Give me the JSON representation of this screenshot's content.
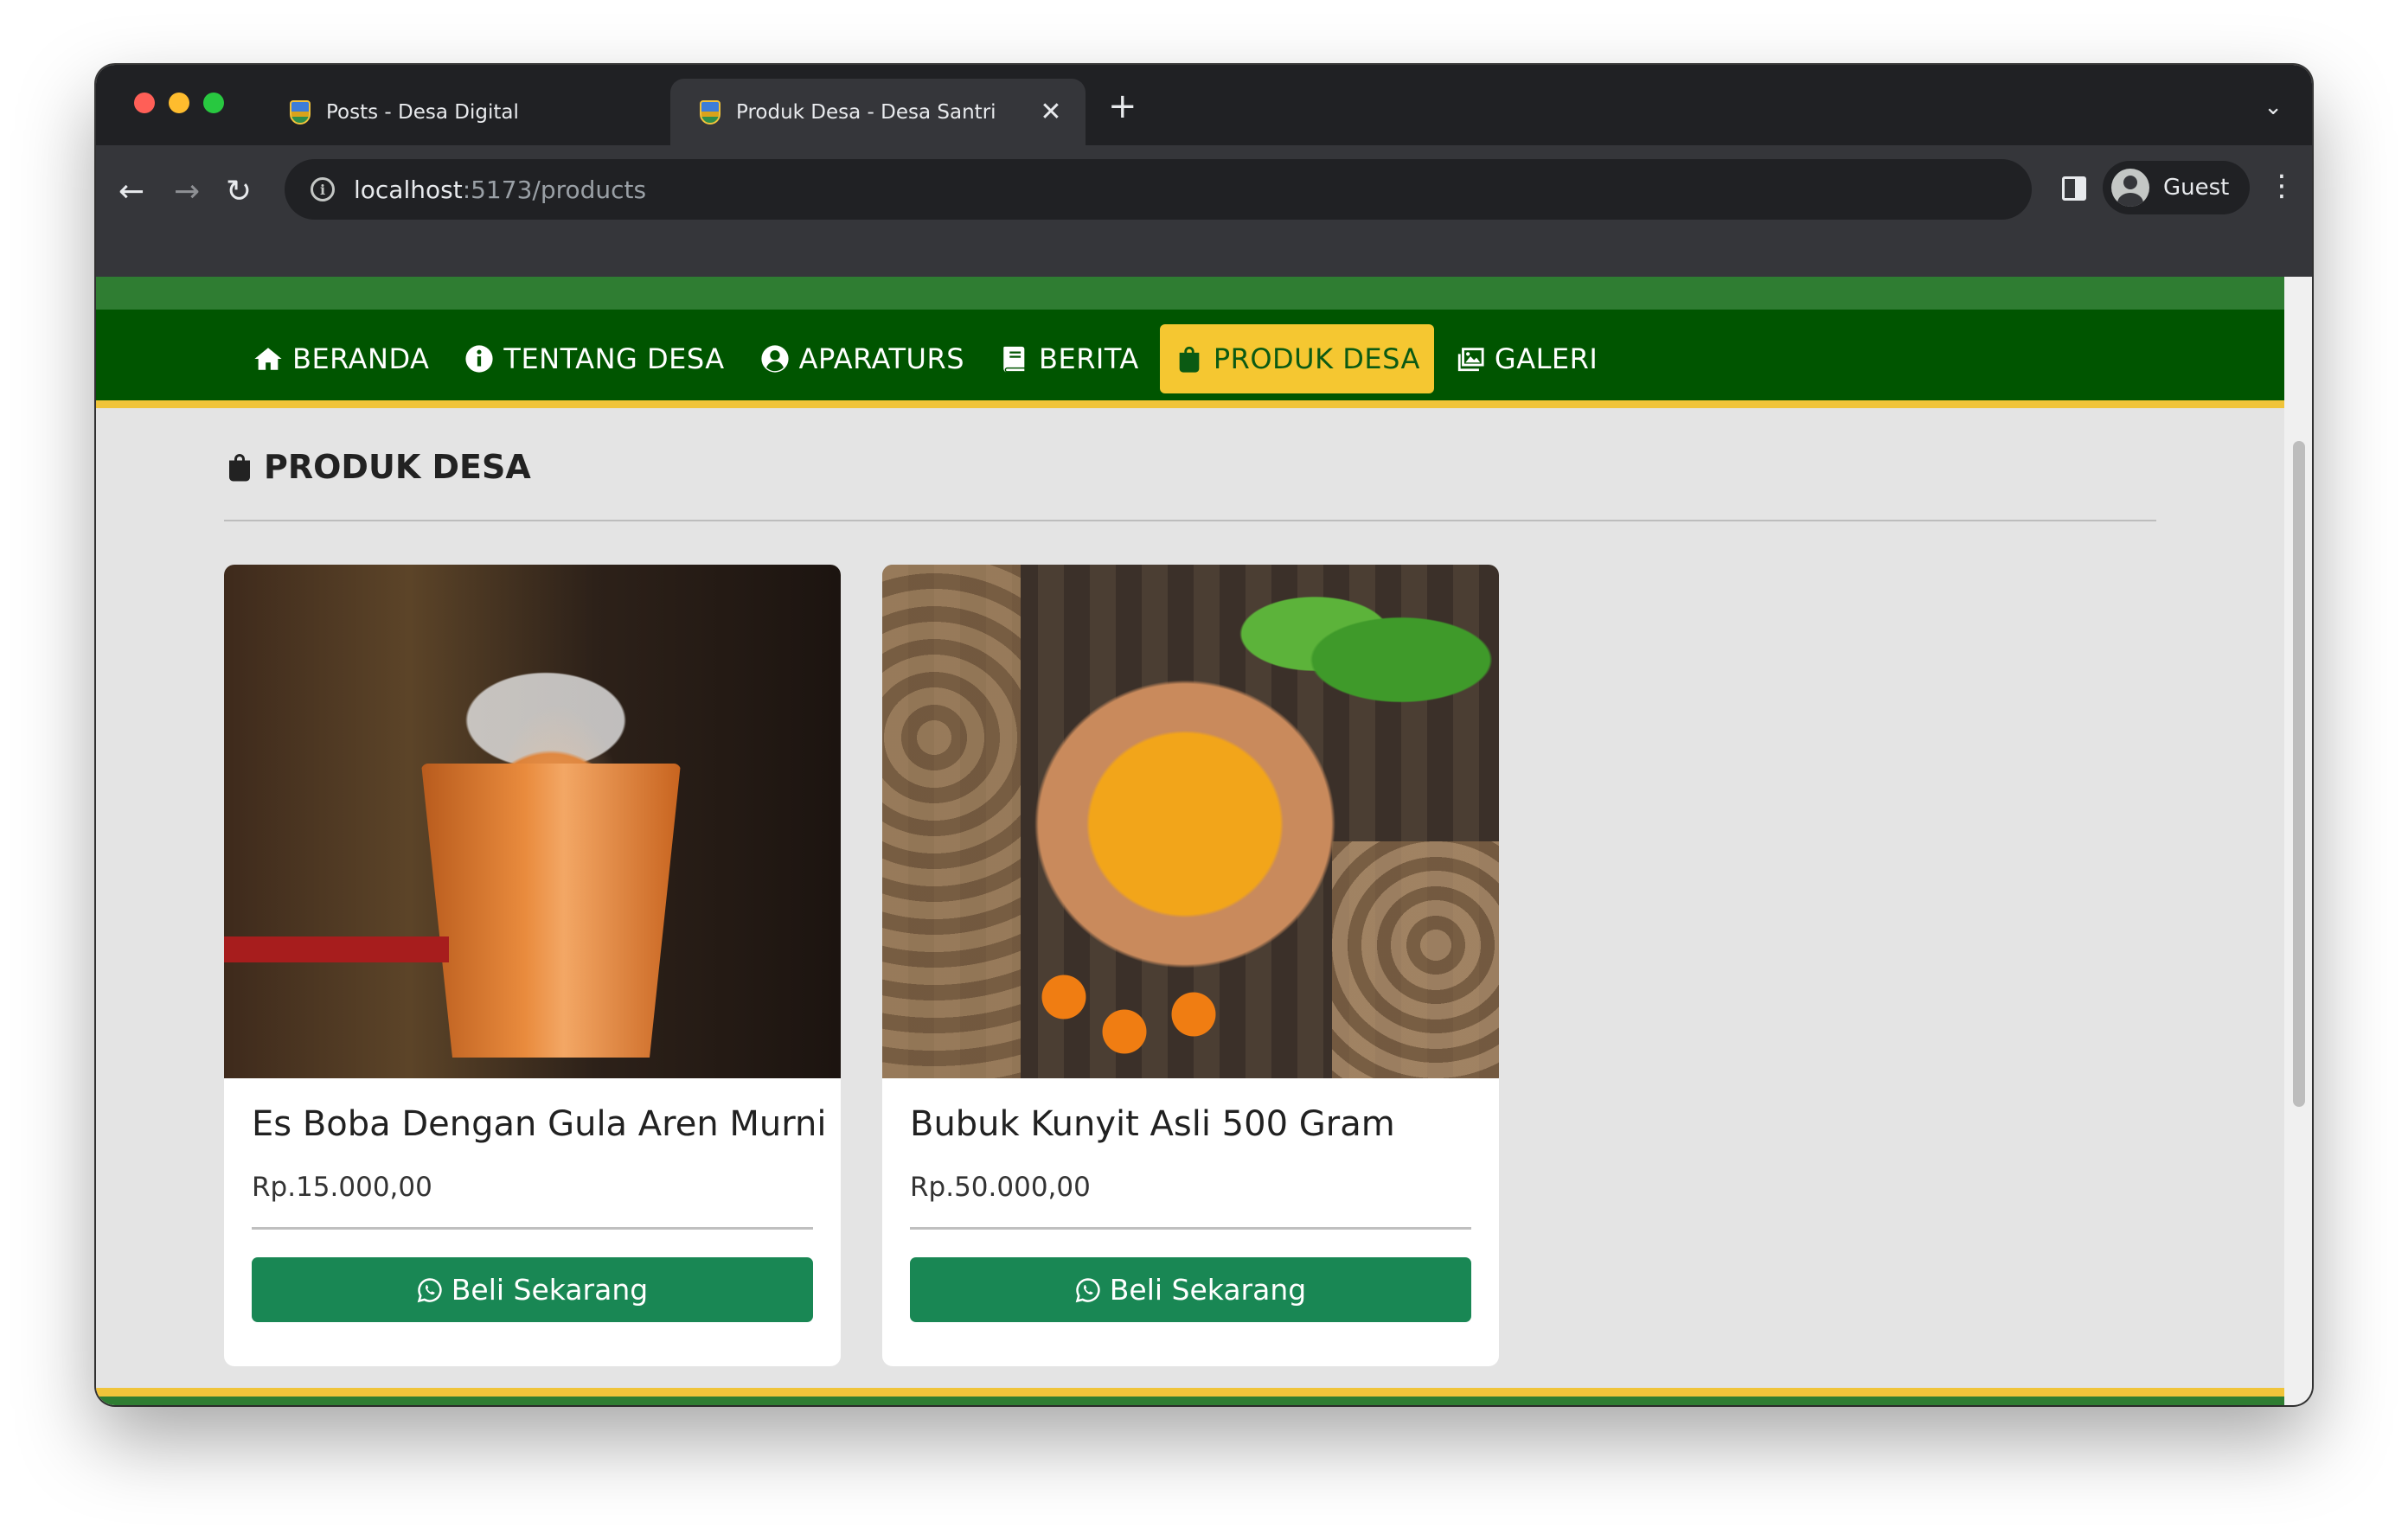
{
  "browser": {
    "tabs": [
      {
        "title": "Posts - Desa Digital",
        "active": false
      },
      {
        "title": "Produk Desa - Desa Santri",
        "active": true
      }
    ],
    "new_tab_label": "+",
    "close_glyph": "✕",
    "url_host": "localhost",
    "url_path": ":5173/products",
    "profile_name": "Guest"
  },
  "nav": {
    "items": [
      {
        "label": "BERANDA",
        "icon": "home-icon"
      },
      {
        "label": "TENTANG DESA",
        "icon": "info-icon"
      },
      {
        "label": "APARATURS",
        "icon": "user-circle-icon"
      },
      {
        "label": "BERITA",
        "icon": "book-icon"
      },
      {
        "label": "PRODUK DESA",
        "icon": "shopping-bag-icon",
        "active": true
      },
      {
        "label": "GALERI",
        "icon": "images-icon"
      }
    ]
  },
  "page": {
    "heading": "PRODUK DESA",
    "heading_icon": "shopping-bag-icon"
  },
  "products": [
    {
      "name": "Es Boba Dengan Gula Aren Murni",
      "price": "Rp.15.000,00",
      "button_label": "Beli Sekarang",
      "image": "iced-milk-tea-cup-photo"
    },
    {
      "name": "Bubuk Kunyit Asli 500 Gram",
      "price": "Rp.50.000,00",
      "button_label": "Beli Sekarang",
      "image": "turmeric-powder-bowl-photo"
    }
  ],
  "colors": {
    "nav_bg": "#005500",
    "top_strip": "#2f7d32",
    "accent_yellow": "#f5c731",
    "button_green": "#198754",
    "page_bg": "#e4e4e4"
  }
}
